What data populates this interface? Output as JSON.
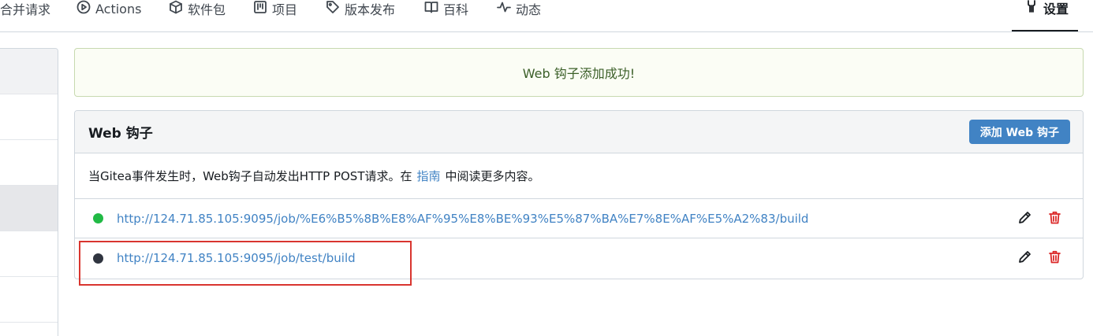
{
  "tabs": [
    {
      "label": "合并请求",
      "icon": "pull-request-icon"
    },
    {
      "label": "Actions",
      "icon": "play-icon"
    },
    {
      "label": "软件包",
      "icon": "package-icon"
    },
    {
      "label": "项目",
      "icon": "project-icon"
    },
    {
      "label": "版本发布",
      "icon": "tag-icon"
    },
    {
      "label": "百科",
      "icon": "book-icon"
    },
    {
      "label": "动态",
      "icon": "pulse-icon"
    },
    {
      "label": "设置",
      "icon": "tools-icon",
      "active": true
    }
  ],
  "flash": {
    "message": "Web 钩子添加成功!"
  },
  "webhooks": {
    "title": "Web 钩子",
    "add_button": "添加 Web 钩子",
    "description_before": "当Gitea事件发生时，Web钩子自动发出HTTP POST请求。在",
    "description_link": "指南",
    "description_after": "中阅读更多内容。",
    "items": [
      {
        "url": "http://124.71.85.105:9095/job/%E6%B5%8B%E8%AF%95%E8%BE%93%E5%87%BA%E7%8E%AF%E5%A2%83/build",
        "status_color": "#21ba45"
      },
      {
        "url": "http://124.71.85.105:9095/job/test/build",
        "status_color": "#303540"
      }
    ]
  },
  "colors": {
    "accent": "#4183c4",
    "success": "#21ba45",
    "danger": "#db2828",
    "annotation": "#d9352f"
  }
}
